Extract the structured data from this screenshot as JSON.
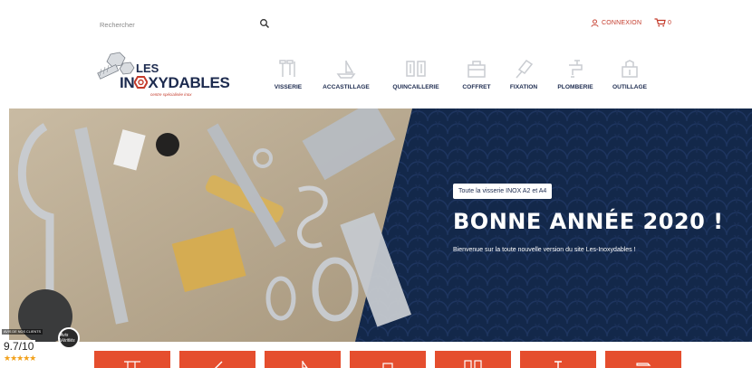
{
  "topbar": {
    "search_label": "Rechercher",
    "login_label": "CONNEXION",
    "cart_count": "0"
  },
  "logo": {
    "les": "LES",
    "name_part1": "IN",
    "name_part2": "XYDABLES",
    "tagline": "centre spécialisée inox"
  },
  "nav": {
    "items": [
      {
        "label": "VISSERIE",
        "icon": "screws-icon"
      },
      {
        "label": "ACCASTILLAGE",
        "icon": "boat-icon"
      },
      {
        "label": "QUINCAILLERIE",
        "icon": "hardware-icon"
      },
      {
        "label": "COFFRET",
        "icon": "toolbox-icon"
      },
      {
        "label": "FIXATION",
        "icon": "fixation-icon"
      },
      {
        "label": "PLOMBERIE",
        "icon": "faucet-icon"
      },
      {
        "label": "OUTILLAGE",
        "icon": "tools-icon"
      }
    ]
  },
  "hero": {
    "badge": "Toute la visserie INOX A2 et A4",
    "title": "BONNE ANNÉE 2020 !",
    "subtitle": "Bienvenue sur la toute nouvelle version du site Les-Inoxydables !"
  },
  "rating": {
    "label": "AVIS DE NOS CLIENTS",
    "score": "9.7/10",
    "stars": "★★★★★",
    "seal_text": "Avis Vérifiés"
  },
  "colors": {
    "accent": "#e54e2e",
    "navy": "#14284a",
    "brand_red": "#c43a2a"
  }
}
